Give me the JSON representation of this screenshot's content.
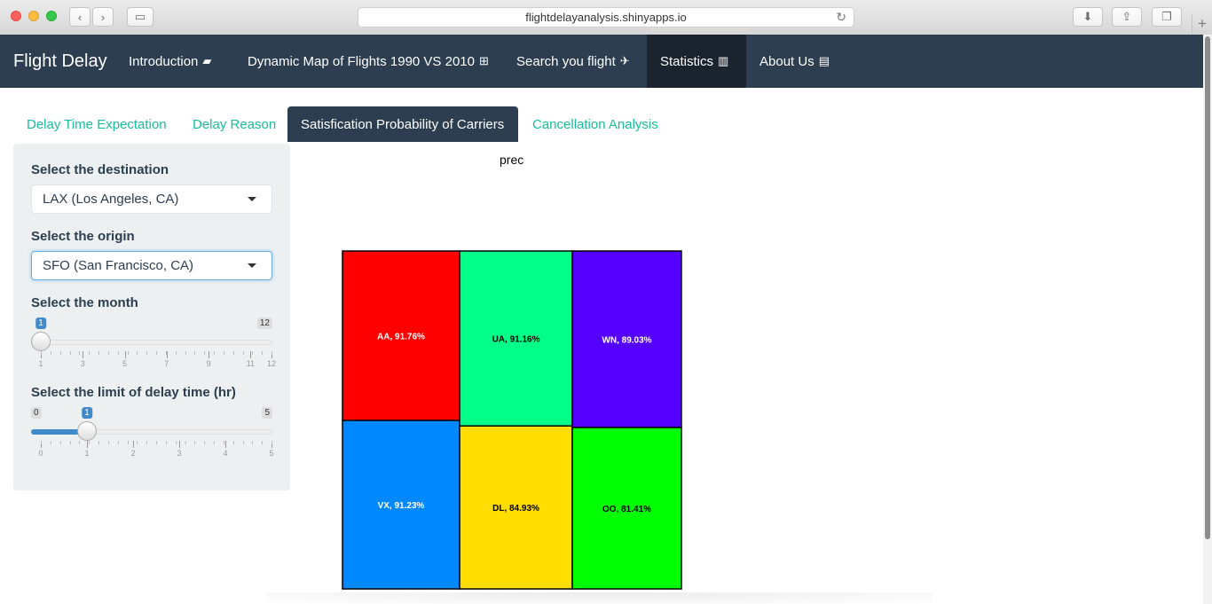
{
  "browser": {
    "url": "flightdelayanalysis.shinyapps.io"
  },
  "navbar": {
    "brand": "Flight Delay",
    "items": [
      {
        "label": "Introduction",
        "icon": "book-icon",
        "glyph": "📘"
      },
      {
        "label": "Dynamic Map of Flights 1990 VS 2010",
        "icon": "map-icon",
        "glyph": "🗺"
      },
      {
        "label": "Search you flight",
        "icon": "plane-icon",
        "glyph": "✈"
      },
      {
        "label": "Statistics",
        "icon": "bar-chart-icon",
        "glyph": "📊"
      },
      {
        "label": "About Us",
        "icon": "id-card-icon",
        "glyph": "🪪"
      }
    ],
    "active": "Statistics"
  },
  "tabs": [
    {
      "label": "Delay Time Expectation"
    },
    {
      "label": "Delay Reason"
    },
    {
      "label": "Satisfication Probability of Carriers"
    },
    {
      "label": "Cancellation Analysis"
    }
  ],
  "sidebar": {
    "destination": {
      "label": "Select the destination",
      "value": "LAX (Los Angeles, CA)"
    },
    "origin": {
      "label": "Select the origin",
      "value": "SFO (San Francisco, CA)"
    },
    "month": {
      "label": "Select the month",
      "min": "1",
      "max": "12",
      "value": 1,
      "range": [
        1,
        12
      ],
      "ticks": [
        "1",
        "3",
        "5",
        "7",
        "9",
        "11",
        "12"
      ]
    },
    "delay": {
      "label": "Select the limit of delay time (hr)",
      "min": "0",
      "max": "5",
      "value": 1,
      "range": [
        0,
        5
      ],
      "ticks": [
        "0",
        "1",
        "2",
        "3",
        "4",
        "5"
      ]
    }
  },
  "chart_data": {
    "type": "treemap",
    "title": "prec",
    "cells": [
      {
        "carrier": "AA",
        "value": 91.76,
        "label": "AA, 91.76%",
        "color": "#ff0000",
        "text_color": "#ffffff"
      },
      {
        "carrier": "VX",
        "value": 91.23,
        "label": "VX, 91.23%",
        "color": "#0088ff",
        "text_color": "#ffffff"
      },
      {
        "carrier": "UA",
        "value": 91.16,
        "label": "UA, 91.16%",
        "color": "#00ff88",
        "text_color": "#000000"
      },
      {
        "carrier": "DL",
        "value": 84.93,
        "label": "DL, 84.93%",
        "color": "#ffdd00",
        "text_color": "#000000"
      },
      {
        "carrier": "WN",
        "value": 89.03,
        "label": "WN, 89.03%",
        "color": "#5500ff",
        "text_color": "#ffffff"
      },
      {
        "carrier": "OO",
        "value": 81.41,
        "label": "OO, 81.41%",
        "color": "#00ff00",
        "text_color": "#000000"
      }
    ]
  }
}
